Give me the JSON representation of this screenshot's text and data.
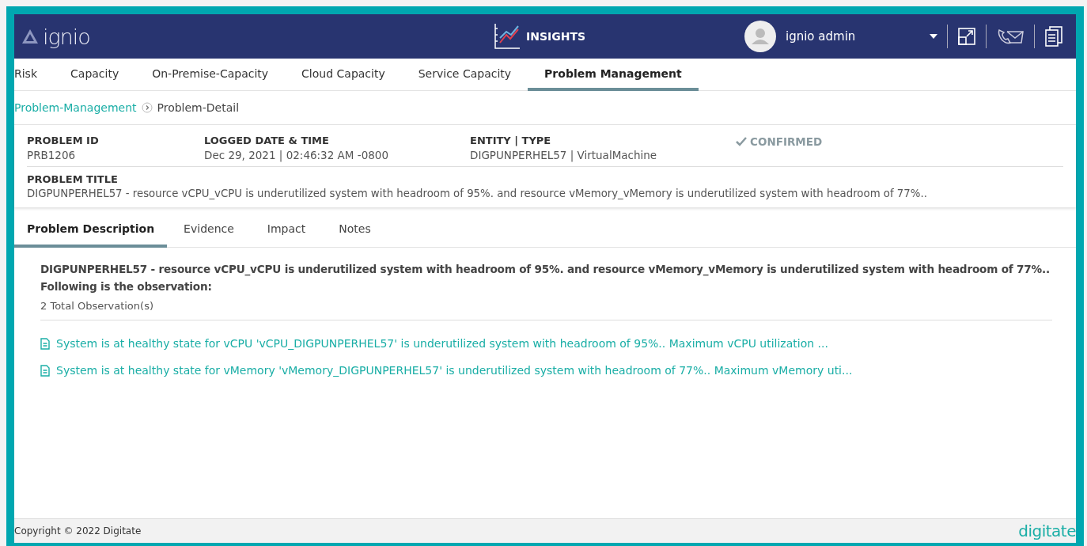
{
  "header": {
    "logo": "ignio",
    "module": "INSIGHTS",
    "user": "ignio admin"
  },
  "tabs": [
    {
      "label": "Risk",
      "selected": false
    },
    {
      "label": "Capacity",
      "selected": false
    },
    {
      "label": "On-Premise-Capacity",
      "selected": false
    },
    {
      "label": "Cloud Capacity",
      "selected": false
    },
    {
      "label": "Service Capacity",
      "selected": false
    },
    {
      "label": "Problem Management",
      "selected": true
    }
  ],
  "breadcrumb": [
    "Problem-Management",
    "Problem-Detail"
  ],
  "details": [
    {
      "label": "PROBLEM ID",
      "value": "PRB1206"
    },
    {
      "label": "LOGGED DATE & TIME",
      "value": "Dec 29, 2021 | 02:46:32 AM -0800"
    },
    {
      "label": "ENTITY | TYPE",
      "value": "DIGPUNPERHEL57 | VirtualMachine"
    }
  ],
  "status": "CONFIRMED",
  "problem_title": {
    "label": "PROBLEM TITLE",
    "value": "DIGPUNPERHEL57 - resource vCPU_vCPU is underutilized system with headroom of 95%. and resource vMemory_vMemory is underutilized system with headroom of 77%.."
  },
  "detail_tabs": [
    {
      "label": "Problem Description",
      "selected": true
    },
    {
      "label": "Evidence",
      "selected": false
    },
    {
      "label": "Impact",
      "selected": false
    },
    {
      "label": "Notes",
      "selected": false
    }
  ],
  "description": {
    "summary": "DIGPUNPERHEL57 - resource vCPU_vCPU is underutilized system with headroom of 95%. and resource vMemory_vMemory is underutilized system with headroom of 77%..",
    "intro": "Following is the observation:",
    "count": "2 Total Observation(s)",
    "observations": [
      "System is at healthy state for vCPU 'vCPU_DIGPUNPERHEL57' is underutilized system with headroom of 95%.. Maximum vCPU utilization ...",
      "System is at healthy state for vMemory 'vMemory_DIGPUNPERHEL57' is underutilized system with headroom of 77%.. Maximum vMemory uti..."
    ]
  },
  "footer": {
    "copyright": "Copyright ©  2022 Digitate",
    "brand": "digitate"
  }
}
